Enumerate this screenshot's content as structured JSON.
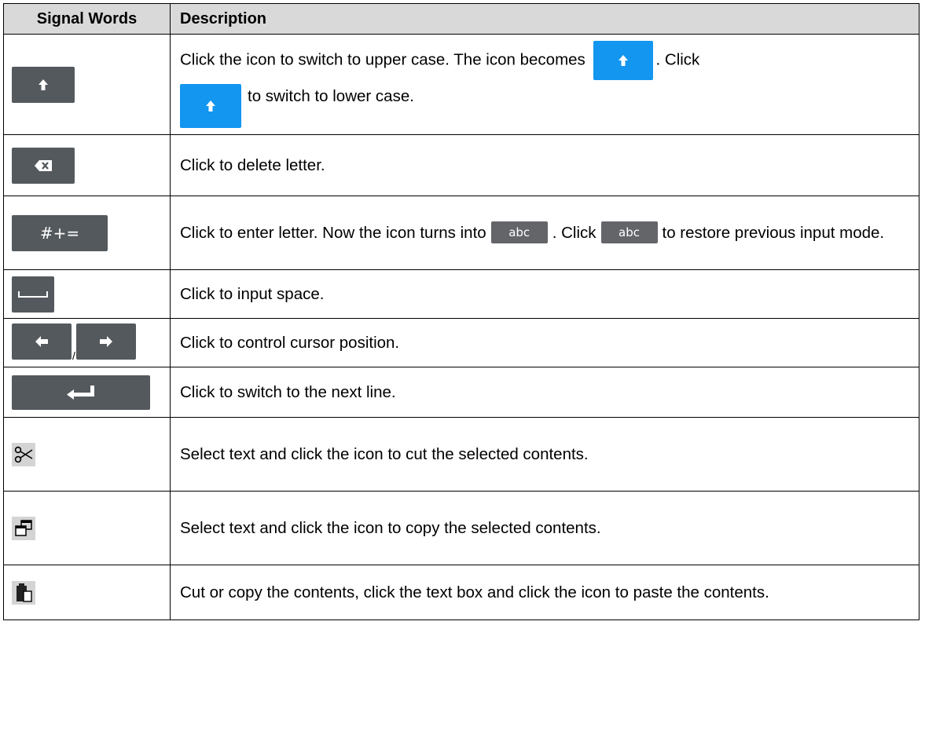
{
  "header": {
    "col1": "Signal Words",
    "col2": "Description"
  },
  "rows": {
    "shift": {
      "icon": "shift-key-icon",
      "desc_a": "Click the icon to switch to upper case. The icon becomes",
      "desc_b": ". Click",
      "desc_c": "to switch to lower case."
    },
    "backspace": {
      "icon": "backspace-key-icon",
      "desc": "Click to delete letter."
    },
    "symbols": {
      "key_label": "#+=",
      "desc_a": "Click to enter letter. Now the icon turns into",
      "abc_label": "abc",
      "desc_b": ". Click",
      "desc_c": "to restore previous input mode."
    },
    "space": {
      "icon": "space-key-icon",
      "desc": "Click to input space."
    },
    "arrows": {
      "slash": "/",
      "desc": "Click to control cursor position."
    },
    "enter": {
      "icon": "enter-key-icon",
      "desc": "Click to switch to the next line."
    },
    "cut": {
      "icon": "scissors-icon",
      "desc": "Select text and click the icon to cut the selected contents."
    },
    "copy": {
      "icon": "copy-icon",
      "desc": "Select text and click the icon to copy the selected contents."
    },
    "paste": {
      "icon": "paste-icon",
      "desc": "Cut or copy the contents, click the text box and click the icon to paste the contents."
    }
  },
  "colors": {
    "key_dark": "#54595e",
    "key_active": "#1296f0",
    "header_bg": "#d9d9d9"
  }
}
